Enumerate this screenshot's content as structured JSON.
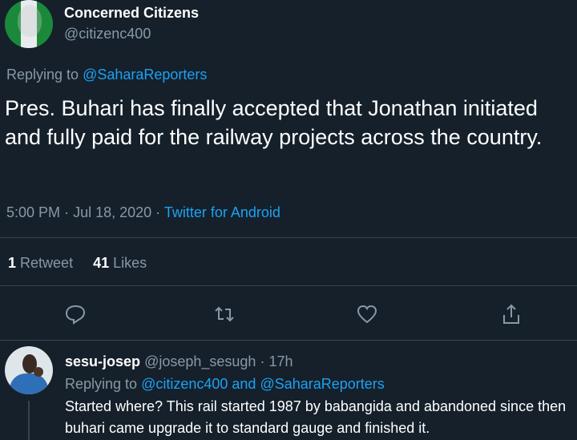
{
  "tweet": {
    "author_name": "Concerned Citizens",
    "author_handle": "@citizenc400",
    "replying_to_prefix": "Replying to",
    "replying_to_handle": "@SaharaReporters",
    "text": "Pres. Buhari has finally accepted that Jonathan initiated and fully paid for the railway projects across the country.",
    "time": "5:00 PM",
    "date": "Jul 18, 2020",
    "separator": "·",
    "source": "Twitter for Android",
    "retweets_count": "1",
    "retweets_label": "Retweet",
    "likes_count": "41",
    "likes_label": "Likes"
  },
  "actions": {
    "reply_icon": "reply-icon",
    "retweet_icon": "retweet-icon",
    "like_icon": "heart-icon",
    "share_icon": "share-icon"
  },
  "reply": {
    "author_name": "sesu-josep",
    "author_handle": "@joseph_sesugh",
    "separator": "·",
    "time_ago": "17h",
    "replying_to_prefix": "Replying to",
    "replying_to_handles": "@citizenc400 and @SaharaReporters",
    "text": "Started where? This rail started 1987 by babangida and abandoned since then buhari came upgrade it to standard gauge and finished it."
  },
  "colors": {
    "background": "#15202b",
    "accent": "#1da1f2",
    "muted": "#8899a6",
    "divider": "#38444d"
  }
}
